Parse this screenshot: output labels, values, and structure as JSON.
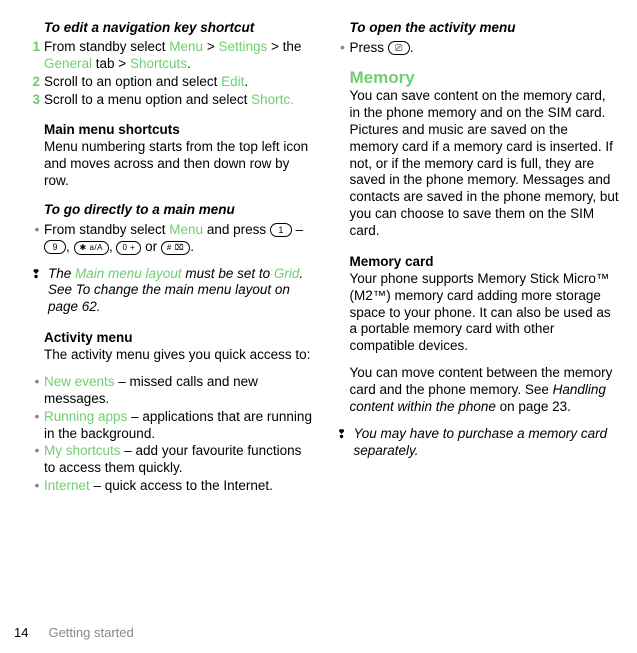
{
  "left": {
    "navEdit": {
      "title": "To edit a navigation key shortcut",
      "steps": [
        {
          "n": "1",
          "pre": "From standby select ",
          "l1": "Menu",
          "mid": " > ",
          "l2": "Settings",
          "mid2": " > the ",
          "l3": "General",
          "mid3": " tab > ",
          "l4": "Shortcuts",
          "post": "."
        },
        {
          "n": "2",
          "pre": "Scroll to an option and select ",
          "l1": "Edit",
          "post": "."
        },
        {
          "n": "3",
          "pre": "Scroll to a menu option and select ",
          "l1": "Shortc.",
          "post": ""
        }
      ]
    },
    "mainMenuShortcuts": {
      "title": "Main menu shortcuts",
      "text": "Menu numbering starts from the top left icon and moves across and then down row by row."
    },
    "goDirectly": {
      "title": "To go directly to a main menu",
      "pre": "From standby select ",
      "menu": "Menu",
      "post1": " and press ",
      "k1": "1",
      "dash": " – ",
      "k2": "9",
      "comma": ", ",
      "k3": "✱ a/A",
      "k4": "0 +",
      "or": " or ",
      "k5": "# ⌧",
      "end": "."
    },
    "note1": {
      "pre": "The ",
      "link": "Main menu layout",
      "post": " must be set to ",
      "link2": "Grid",
      "rest": ". See To change the main menu layout on page 62."
    },
    "activityMenu": {
      "title": "Activity menu",
      "text": "The activity menu gives you quick access to:",
      "items": [
        {
          "l": "New events",
          "t": " – missed calls and new messages."
        },
        {
          "l": "Running apps",
          "t": " – applications that are running in the background."
        },
        {
          "l": "My shortcuts",
          "t": " – add your favourite functions to access them quickly."
        },
        {
          "l": "Internet",
          "t": " – quick access to the Internet."
        }
      ]
    }
  },
  "right": {
    "openActivity": {
      "title": "To open the activity menu",
      "pre": "Press ",
      "key": "⎚",
      "post": "."
    },
    "memory": {
      "title": "Memory",
      "p1": "You can save content on the memory card, in the phone memory and on the SIM card. Pictures and music are saved on the memory card if a memory card is inserted. If not, or if the memory card is full, they are saved in the phone memory. Messages and contacts are saved in the phone memory, but you can choose to save them on the SIM card."
    },
    "memoryCard": {
      "title": "Memory card",
      "p1": "Your phone supports Memory Stick Micro™ (M2™) memory card adding more storage space to your phone. It can also be used as a portable memory card with other compatible devices.",
      "p2pre": "You can move content between the memory card and the phone memory. See ",
      "p2em": "Handling content within the phone",
      "p2post": " on page 23."
    },
    "note2": "You may have to purchase a memory card separately."
  },
  "footer": {
    "page": "14",
    "crumb": "Getting started"
  }
}
